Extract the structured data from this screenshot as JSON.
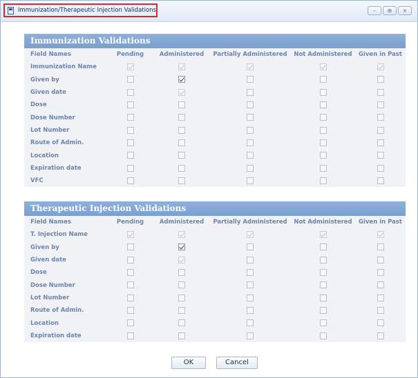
{
  "window": {
    "title": "Immunization/Therapeutic Injection Validations",
    "minimize_glyph": "–",
    "maximize_glyph": "⊕",
    "close_glyph": "×"
  },
  "columns": [
    "Field Names",
    "Pending",
    "Administered",
    "Partially Administered",
    "Not Administered",
    "Given in Past"
  ],
  "immunization": {
    "title": "Immunization Validations",
    "rows": [
      {
        "name": "Immunization Name",
        "states": [
          "locked",
          "locked",
          "locked",
          "locked",
          "locked"
        ]
      },
      {
        "name": "Given by",
        "states": [
          "off",
          "on",
          "off",
          "off",
          "off"
        ]
      },
      {
        "name": "Given date",
        "states": [
          "off",
          "locked",
          "off",
          "off",
          "off"
        ]
      },
      {
        "name": "Dose",
        "states": [
          "off",
          "off",
          "off",
          "off",
          "off"
        ]
      },
      {
        "name": "Dose Number",
        "states": [
          "off",
          "off",
          "off",
          "off",
          "off"
        ]
      },
      {
        "name": "Lot Number",
        "states": [
          "off",
          "off",
          "off",
          "off",
          "off"
        ]
      },
      {
        "name": "Route of Admin.",
        "states": [
          "off",
          "off",
          "off",
          "off",
          "off"
        ]
      },
      {
        "name": "Location",
        "states": [
          "off",
          "off",
          "off",
          "off",
          "off"
        ]
      },
      {
        "name": "Expiration date",
        "states": [
          "off",
          "off",
          "off",
          "off",
          "off"
        ]
      },
      {
        "name": "VFC",
        "states": [
          "off",
          "off",
          "off",
          "off",
          "off"
        ]
      }
    ]
  },
  "therapeutic": {
    "title": "Therapeutic Injection Validations",
    "rows": [
      {
        "name": "T. Injection Name",
        "states": [
          "locked",
          "locked",
          "locked",
          "locked",
          "locked"
        ]
      },
      {
        "name": "Given by",
        "states": [
          "off",
          "on",
          "off",
          "off",
          "off"
        ]
      },
      {
        "name": "Given date",
        "states": [
          "off",
          "locked",
          "off",
          "off",
          "off"
        ]
      },
      {
        "name": "Dose",
        "states": [
          "off",
          "off",
          "off",
          "off",
          "off"
        ]
      },
      {
        "name": "Dose Number",
        "states": [
          "off",
          "off",
          "off",
          "off",
          "off"
        ]
      },
      {
        "name": "Lot Number",
        "states": [
          "off",
          "off",
          "off",
          "off",
          "off"
        ]
      },
      {
        "name": "Route of Admin.",
        "states": [
          "off",
          "off",
          "off",
          "off",
          "off"
        ]
      },
      {
        "name": "Location",
        "states": [
          "off",
          "off",
          "off",
          "off",
          "off"
        ]
      },
      {
        "name": "Expiration date",
        "states": [
          "off",
          "off",
          "off",
          "off",
          "off"
        ]
      }
    ]
  },
  "buttons": {
    "ok": "OK",
    "cancel": "Cancel"
  },
  "colors": {
    "header_bg": "#7aa0d0",
    "panel_bg": "#f0f2f5",
    "label_text": "#6d84ad",
    "highlight_border": "#d42a2a"
  }
}
